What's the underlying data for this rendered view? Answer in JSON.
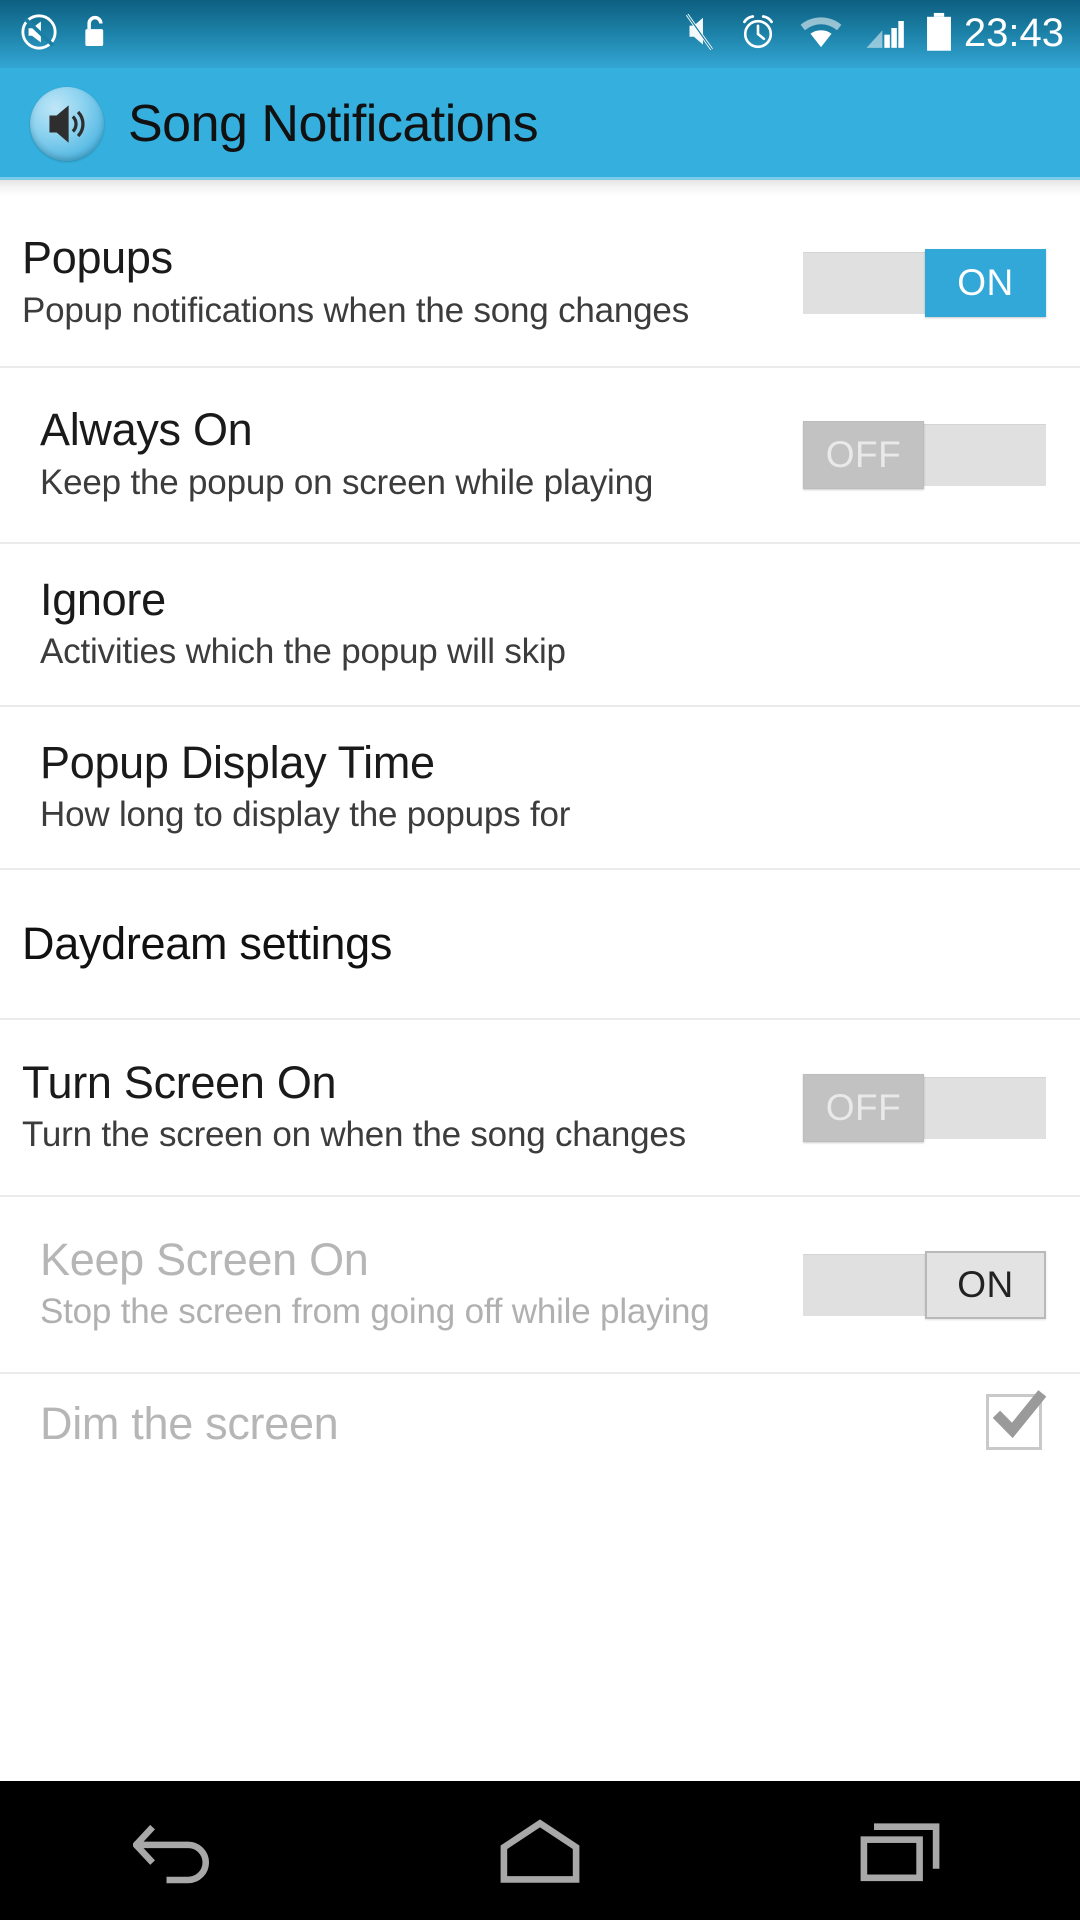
{
  "status_bar": {
    "time": "23:43",
    "left_icons": [
      {
        "name": "volume-muted-icon",
        "label": "volume-mute"
      },
      {
        "name": "unlock-icon",
        "label": "unlocked"
      }
    ],
    "right_icons": [
      {
        "name": "ringer-silent-icon",
        "label": "silent-mode"
      },
      {
        "name": "alarm-clock-icon",
        "label": "alarm-set"
      },
      {
        "name": "wifi-icon",
        "label": "wifi"
      },
      {
        "name": "cellular-signal-icon",
        "label": "signal"
      },
      {
        "name": "battery-icon",
        "label": "battery"
      }
    ]
  },
  "app_bar": {
    "title": "Song Notifications",
    "icon": "speaker-icon"
  },
  "settings": {
    "rows": [
      {
        "key": "popups",
        "title": "Popups",
        "subtitle": "Popup notifications when the song changes",
        "control": "toggle",
        "state": "ON",
        "enabled": true
      },
      {
        "key": "always_on",
        "title": "Always On",
        "subtitle": "Keep the popup on screen while playing",
        "control": "toggle",
        "state": "OFF",
        "enabled": true
      },
      {
        "key": "ignore",
        "title": "Ignore",
        "subtitle": "Activities which the popup will skip",
        "control": "none",
        "enabled": true
      },
      {
        "key": "popup_display_time",
        "title": "Popup Display Time",
        "subtitle": "How long to display the popups for",
        "control": "none",
        "enabled": true
      }
    ],
    "section_header": "Daydream settings",
    "daydream_rows": [
      {
        "key": "turn_screen_on",
        "title": "Turn Screen On",
        "subtitle": "Turn the screen on when the song changes",
        "control": "toggle",
        "state": "OFF",
        "enabled": true
      },
      {
        "key": "keep_screen_on",
        "title": "Keep Screen On",
        "subtitle": "Stop the screen from going off while playing",
        "control": "toggle",
        "state": "ON",
        "enabled": false
      },
      {
        "key": "dim_the_screen",
        "title": "Dim the screen",
        "subtitle": "",
        "control": "checkbox",
        "state": "checked",
        "enabled": false
      }
    ]
  },
  "nav_bar": {
    "buttons": [
      {
        "name": "back-icon",
        "label": "Back"
      },
      {
        "name": "home-icon",
        "label": "Home"
      },
      {
        "name": "recent-apps-icon",
        "label": "Recent apps"
      }
    ]
  },
  "colors": {
    "accent_blue": "#35b0de",
    "status_bar_blue": "#1b7fa5",
    "toggle_on": "#32a8d8",
    "toggle_off_knob": "#c2c2c2",
    "track": "#e0e0e0",
    "divider": "#ebebeb",
    "nav_bar": "#000000",
    "disabled_text": "#b6b6b6"
  }
}
